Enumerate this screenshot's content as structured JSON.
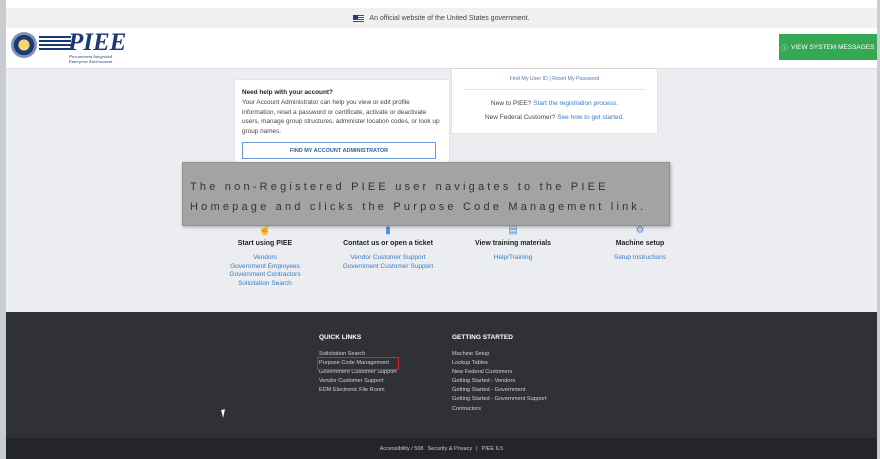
{
  "gov_banner": {
    "flag_icon": "us-flag-icon",
    "text": "An official website of the United States government."
  },
  "header": {
    "logo_text": "PIEE",
    "logo_sub_1": "Procurement Integrated",
    "logo_sub_2": "Enterprise Environment",
    "system_messages_button": "VIEW SYSTEM MESSAGES",
    "system_messages_icon": "info-icon"
  },
  "help_card": {
    "title": "Need help with your account?",
    "body": "Your Account Administrator can help you view or edit profile information, reset a password or certificate, activate or deactivate users, manage group structures, administer location codes, or look up group names.",
    "button": "FIND MY ACCOUNT ADMINISTRATOR"
  },
  "login_card": {
    "find_user_id": "Find My User ID",
    "separator": "|",
    "reset_password": "Reset My Password",
    "new_prefix": "New to PIEE?",
    "new_link": "Start the registration process.",
    "federal_prefix": "New Federal Customer?",
    "federal_link": "See how to get started."
  },
  "caption": "The non-Registered PIEE user navigates to the PIEE Homepage and clicks the Purpose Code Management link.",
  "columns": [
    {
      "icon": "hand-pointer-icon",
      "title": "Start using PIEE",
      "links": [
        "Vendors",
        "Government Employees",
        "Government Contractors",
        "Solicitation Search"
      ]
    },
    {
      "icon": "chat-icon",
      "title": "Contact us or open a ticket",
      "links": [
        "Vendor Customer Support",
        "Government Customer Support"
      ]
    },
    {
      "icon": "document-icon",
      "title": "View training materials",
      "links": [
        "Help/Training"
      ]
    },
    {
      "icon": "gear-icon",
      "title": "Machine setup",
      "links": [
        "Setup Instructions"
      ]
    }
  ],
  "footer": {
    "quick_links": {
      "title": "QUICK LINKS",
      "items": [
        "Solicitation Search",
        "Purpose Code Management",
        "Government Customer Support",
        "Vendor Customer Support",
        "EDM Electronic File Room"
      ]
    },
    "getting_started": {
      "title": "GETTING STARTED",
      "items": [
        "Machine Setup",
        "Lookup Tables",
        "New Federal Customers",
        "Getting Started - Vendors",
        "Getting Started - Government",
        "Getting Started - Government Support",
        "Contractors"
      ]
    },
    "highlight_color": "#e02020"
  },
  "bottom_bar": {
    "accessibility": "Accessibility / 508",
    "security": "Security & Privacy",
    "separator": "|",
    "version": "PIEE 6.5"
  },
  "colors": {
    "brand": "#1b3a73",
    "accent_green": "#35a853",
    "link": "#3b7bc3",
    "footer_bg": "#2f3135"
  }
}
